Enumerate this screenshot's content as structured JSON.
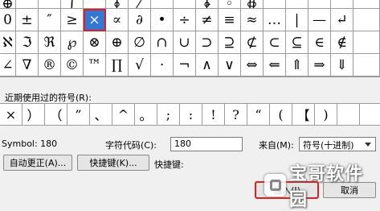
{
  "symbol_rows": [
    [
      "⊕",
      "",
      "",
      "∫",
      "",
      "∮",
      "⁄",
      "",
      "",
      "∳",
      "◦",
      "∯",
      "",
      "",
      "",
      "",
      ""
    ],
    [
      "0",
      "±",
      "″",
      "≥",
      "×",
      "∝",
      "∂",
      "•",
      "÷",
      "≠",
      "≡",
      "≈",
      "…",
      "|",
      "—",
      "↵",
      ""
    ],
    [
      "ℵ",
      "ℑ",
      "ℜ",
      "℘",
      "⊗",
      "⊕",
      "∅",
      "∩",
      "∪",
      "⊃",
      "⊇",
      "⊄",
      "⊂",
      "⊆",
      "∈",
      "∉",
      ""
    ],
    [
      "∠",
      "∇",
      "®",
      "©",
      "™",
      "∏",
      "√",
      "⋅",
      "¬",
      "∧",
      "∨",
      "⇔",
      "⇐",
      "⇑",
      "⇒",
      "⇓",
      ""
    ]
  ],
  "selected_symbol": "×",
  "recent_label": "近期使用过的符号(R):",
  "recent_symbols": [
    "×",
    "）",
    "（",
    "”",
    "、",
    "^",
    "。",
    ";",
    ":",
    "!",
    "?",
    "“",
    "(",
    "【",
    ")",
    "",
    ""
  ],
  "symbol_name": "Symbol: 180",
  "char_code_label": "字符代码(C):",
  "char_code_value": "180",
  "from_label": "来自(M):",
  "from_value": "符号(十进制)",
  "buttons": {
    "autocorrect": "自动更正(A)...",
    "shortcut_key": "快捷键(K)...",
    "shortcut_label": "快捷键:",
    "insert": "插入(I)",
    "cancel": "取消"
  },
  "watermark": "宝哥软件园"
}
